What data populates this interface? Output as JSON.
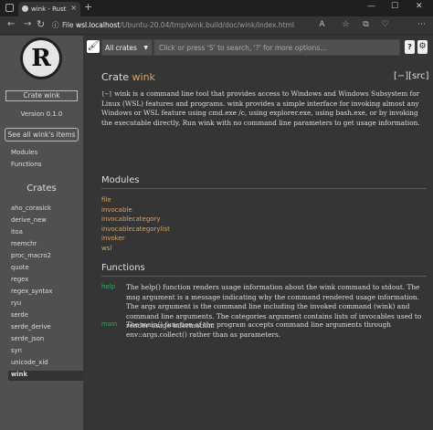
{
  "browser": {
    "tab_title": "wink - Rust",
    "new_tab": "+",
    "file_label": "File",
    "url_host": "wsl.localhost",
    "url_path": "/Ubuntu-20.04/tmp/wink.build/doc/wink/index.html"
  },
  "sidebar": {
    "crate_button": "Crate wink",
    "version": "Version 0.1.0",
    "all_items": "See all wink's items",
    "nav": [
      "Modules",
      "Functions"
    ],
    "crates_heading": "Crates",
    "crates": [
      "aho_corasick",
      "derive_new",
      "itoa",
      "memchr",
      "proc_macro2",
      "quote",
      "regex",
      "regex_syntax",
      "ryu",
      "serde",
      "serde_derive",
      "serde_json",
      "syn",
      "unicode_xid",
      "wink"
    ],
    "current_crate_index": 14
  },
  "search": {
    "select_value": "All crates",
    "placeholder": "Click or press 'S' to search, '?' for more options...",
    "help_label": "?",
    "settings_icon": "gear-icon"
  },
  "main": {
    "title_prefix": "Crate ",
    "title_name": "wink",
    "src_label": "[−][src]",
    "toggle": "[−]",
    "description": " wink is a command line tool that provides access to Windows and Windows Subsystem for Linux (WSL) features and programs. wink provides a simple interface for invoking almost any Windows or WSL feature using cmd.exe /c, using explorer.exe, using bash.exe, or by invoking the executable directly. Run wink with no command line parameters to get usage information.",
    "modules_heading": "Modules",
    "modules": [
      "file",
      "invocable",
      "invocablecategory",
      "invocablecategorylist",
      "invoker",
      "wsl"
    ],
    "functions_heading": "Functions",
    "functions": [
      {
        "name": "help",
        "desc": "The help() function renders usage information about the wink command to stdout. The msg argument is a message indicating why the command rendered usage information. The args argument is the command line including the invoked command (wink) and command line arguments. The categories argument contains lists of invocables used to render usage information."
      },
      {
        "name": "main",
        "desc": "The main() function of the program accepts command line arguments through env::args.collect() rather than as parameters."
      }
    ]
  },
  "colors": {
    "link": "#d3a56e",
    "function": "#2bab63",
    "sidebar": "#505050",
    "background": "#353535"
  }
}
